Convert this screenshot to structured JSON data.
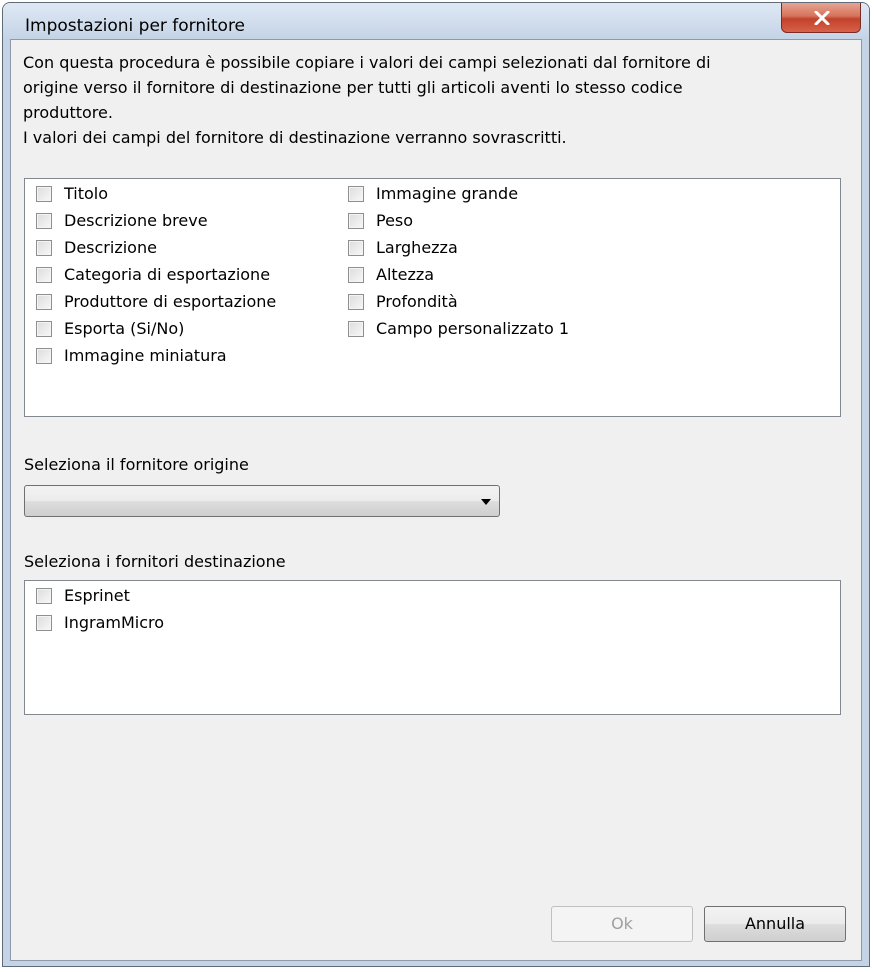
{
  "window": {
    "title": "Impostazioni per fornitore"
  },
  "intro": {
    "lines": [
      "Con questa procedura è possibile copiare i valori dei campi selezionati dal fornitore di",
      "origine verso il fornitore di destinazione per tutti gli articoli aventi lo stesso codice",
      "produttore.",
      "I valori dei campi del fornitore di destinazione verranno sovrascritti."
    ]
  },
  "fields": {
    "column1": [
      {
        "label": "Titolo",
        "checked": false
      },
      {
        "label": "Descrizione breve",
        "checked": false
      },
      {
        "label": "Descrizione",
        "checked": false
      },
      {
        "label": "Categoria di esportazione",
        "checked": false
      },
      {
        "label": "Produttore di esportazione",
        "checked": false
      },
      {
        "label": "Esporta (Si/No)",
        "checked": false
      },
      {
        "label": "Immagine miniatura",
        "checked": false
      }
    ],
    "column2": [
      {
        "label": "Immagine grande",
        "checked": false
      },
      {
        "label": "Peso",
        "checked": false
      },
      {
        "label": "Larghezza",
        "checked": false
      },
      {
        "label": "Altezza",
        "checked": false
      },
      {
        "label": "Profondità",
        "checked": false
      },
      {
        "label": "Campo personalizzato 1",
        "checked": false
      }
    ]
  },
  "source": {
    "label": "Seleziona il fornitore origine",
    "selected_value": ""
  },
  "destination": {
    "label": "Seleziona i fornitori destinazione",
    "items": [
      {
        "label": "Esprinet",
        "checked": false
      },
      {
        "label": "IngramMicro",
        "checked": false
      }
    ]
  },
  "buttons": {
    "ok": "Ok",
    "cancel": "Annulla",
    "ok_enabled": false
  }
}
